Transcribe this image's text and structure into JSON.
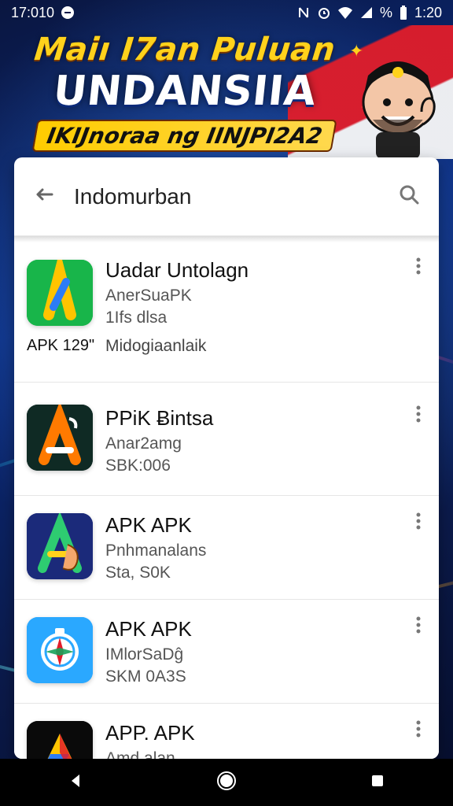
{
  "status_bar": {
    "time": "17:010",
    "battery_text": "%",
    "clock_right": "1:20",
    "icons": [
      "notification-icon",
      "mute-icon",
      "alarm-icon",
      "wifi-icon",
      "signal-icon",
      "battery-icon"
    ]
  },
  "banner": {
    "line1": "Maiı I7an Puluan",
    "line2": "UNDANSIIA",
    "line3": "IKIJnoraa ng IINJPI2A2",
    "colors": {
      "title_yellow": "#ffd21c",
      "flag_red": "#e11d2a"
    }
  },
  "toolbar": {
    "title": "Indomurban",
    "back_icon": "arrow-left-icon",
    "search_icon": "search-icon"
  },
  "apps": [
    {
      "title": "Uadar Untolagn",
      "subtitle1": "AnerSuaPK",
      "subtitle2": "1Ifs dlsa",
      "meta_left": "APK 129\"",
      "meta_right": "Midogiaanlaik",
      "icon": "app-icon-green-a"
    },
    {
      "title": "PPiK Ƀintsa",
      "subtitle1": "Anar2amg",
      "subtitle2": "SBK:006",
      "icon": "app-icon-dark-a"
    },
    {
      "title": "APK APK",
      "subtitle1": "Pnhmanalans",
      "subtitle2": "Sta, S0K",
      "icon": "app-icon-hand-a"
    },
    {
      "title": "APK APK",
      "subtitle1": "IMlorSaDĝ",
      "subtitle2": "SKM 0A3S",
      "icon": "app-icon-compass"
    },
    {
      "title": "APP. APK",
      "subtitle1": "Amd alan",
      "icon": "app-icon-drive"
    }
  ],
  "nav_bar": {
    "buttons": [
      "back-nav-icon",
      "home-nav-icon",
      "recents-nav-icon"
    ]
  }
}
